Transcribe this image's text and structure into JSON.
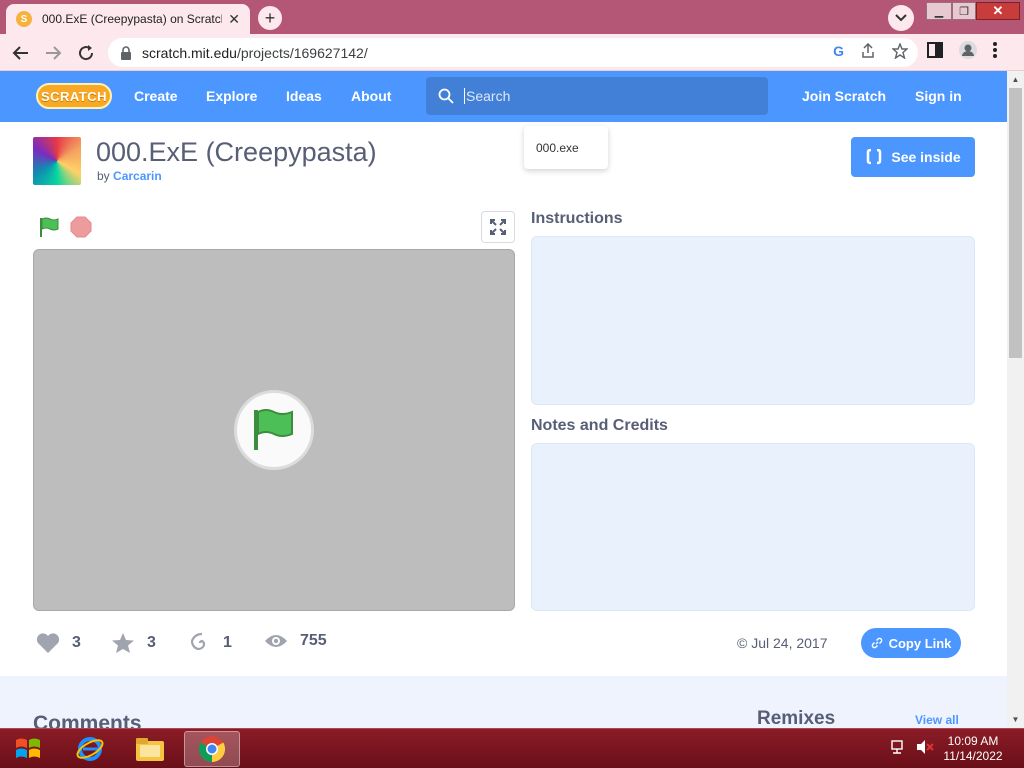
{
  "browser": {
    "tab_title": "000.ExE (Creepypasta) on Scratch",
    "tab_favicon": "S",
    "url_host": "scratch.mit.edu",
    "url_path": "/projects/169627142/"
  },
  "nav": {
    "logo": "SCRATCH",
    "create": "Create",
    "explore": "Explore",
    "ideas": "Ideas",
    "about": "About",
    "search_placeholder": "Search",
    "join": "Join Scratch",
    "signin": "Sign in"
  },
  "search_suggestion": "000.exe",
  "project": {
    "title": "000.ExE (Creepypasta)",
    "by_label": "by",
    "author": "Carcarin",
    "see_inside": "See inside",
    "instructions_heading": "Instructions",
    "notes_heading": "Notes and Credits"
  },
  "stats": {
    "loves": "3",
    "favorites": "3",
    "remixes": "1",
    "views": "755",
    "date": "© Jul 24, 2017",
    "copy_link": "Copy Link"
  },
  "lower": {
    "comments": "Comments",
    "remixes": "Remixes",
    "view_all": "View all"
  },
  "taskbar": {
    "time": "10:09 AM",
    "date": "11/14/2022"
  },
  "colors": {
    "scratch_blue": "#4c97ff",
    "scratch_text": "#575e75",
    "tab_strip": "#b45675",
    "taskbar": "#7a1620"
  }
}
